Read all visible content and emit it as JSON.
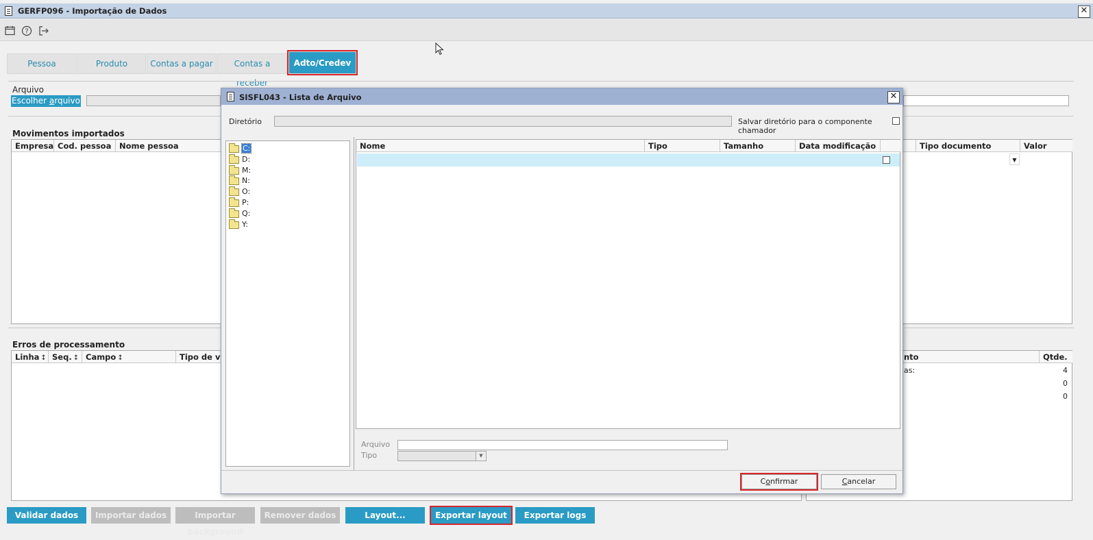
{
  "window": {
    "title": "GERFP096 - Importação de Dados",
    "close": "✕"
  },
  "toolbar": {
    "calendar": "calendar-icon",
    "help": "help-icon",
    "exit": "exit-icon"
  },
  "tabs": [
    {
      "label": "Pessoa"
    },
    {
      "label": "Produto"
    },
    {
      "label": "Contas a pagar"
    },
    {
      "label": "Contas a receber"
    },
    {
      "label": "Adto/Credev"
    }
  ],
  "arquivo": {
    "label": "Arquivo",
    "button": "Escolher arquivo",
    "button_pre": "Escolher ",
    "button_u": "a",
    "button_post": "rquivo"
  },
  "movimentos": {
    "label": "Movimentos importados",
    "columns": [
      "Empresa",
      "Cod. pessoa",
      "Nome pessoa"
    ],
    "right_columns": [
      "Tipo documento",
      "Valor"
    ]
  },
  "erros": {
    "label": "Erros de processamento",
    "columns": [
      "Linha",
      "Seq.",
      "Campo",
      "Tipo de vali"
    ]
  },
  "resumo": {
    "col_left": "nto",
    "col_right": "Qtde.",
    "rows": [
      {
        "label": "as:",
        "qty": "4"
      },
      {
        "label": "",
        "qty": "0"
      },
      {
        "label": "",
        "qty": "0"
      }
    ]
  },
  "bottom_buttons": [
    {
      "label": "Validar dados"
    },
    {
      "label": "Importar dados"
    },
    {
      "label": "Importar background"
    },
    {
      "label": "Remover dados"
    },
    {
      "label": "Layout..."
    },
    {
      "label": "Exportar layout"
    },
    {
      "label": "Exportar logs"
    }
  ],
  "dialog": {
    "title": "SISFL043 - Lista de Arquivo",
    "close": "✕",
    "diretorio_label": "Diretório",
    "salvar_label": "Salvar diretório para o componente chamador",
    "drives": [
      "C:",
      "D:",
      "M:",
      "N:",
      "O:",
      "P:",
      "Q:",
      "Y:"
    ],
    "columns": [
      "Nome",
      "Tipo",
      "Tamanho",
      "Data modificação"
    ],
    "arquivo_label": "Arquivo",
    "tipo_label": "Tipo",
    "confirm_pre": "C",
    "confirm_u": "o",
    "confirm_post": "nfirmar",
    "confirm": "Confirmar",
    "cancel_u": "C",
    "cancel_post": "ancelar",
    "cancel": "Cancelar"
  },
  "colors": {
    "accent": "#2a9bc4",
    "highlight": "#d7262b",
    "title_bar": "#c4d3e6",
    "dialog_title": "#9fb1d3"
  }
}
